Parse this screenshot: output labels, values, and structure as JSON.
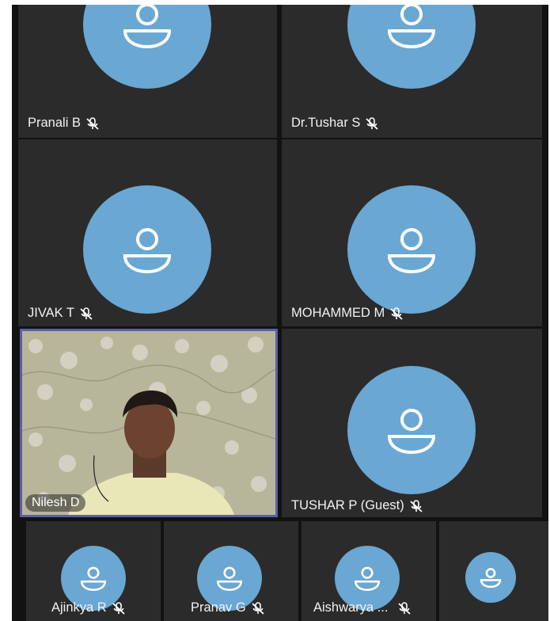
{
  "participants_large": [
    {
      "name": "Pranali B",
      "muted": true
    },
    {
      "name": "Dr.Tushar S",
      "muted": true
    },
    {
      "name": "JIVAK T",
      "muted": true
    },
    {
      "name": "MOHAMMED M",
      "muted": true
    }
  ],
  "video_participant": {
    "name": "Nilesh D"
  },
  "tushar_tile": {
    "name": "TUSHAR P (Guest)",
    "muted": true
  },
  "participants_small": [
    {
      "name": "Ajinkya R",
      "muted": true
    },
    {
      "name": "Pranav G",
      "muted": true
    },
    {
      "name": "Aishwarya ...",
      "muted": true
    },
    {
      "name": "",
      "muted": false
    }
  ],
  "colors": {
    "background": "#121212",
    "tile": "#2b2b2b",
    "avatar": "#6aa7d3",
    "active_speaker_border": "#5c5ea8"
  },
  "icons": {
    "avatar": "person-icon",
    "muted": "mic-off-icon"
  }
}
